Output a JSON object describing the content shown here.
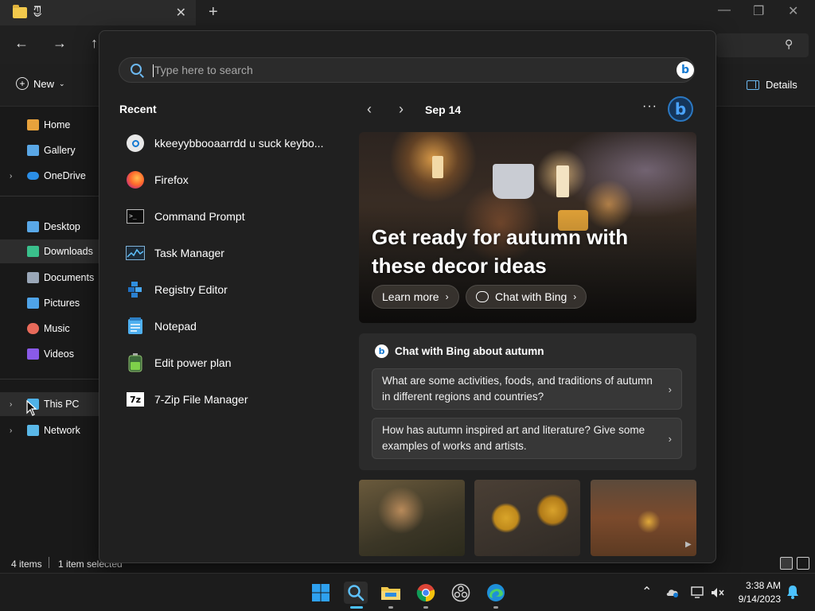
{
  "explorer": {
    "tab_title": "ཀྱ",
    "command_bar": {
      "new_label": "New",
      "details_label": "Details"
    },
    "sidebar": [
      {
        "label": "Home",
        "color": "#e8a23c"
      },
      {
        "label": "Gallery",
        "color": "#5aa7e6"
      },
      {
        "label": "OneDrive",
        "color": "#2b8ee6"
      },
      {
        "label": "Desktop",
        "color": "#59a8e8"
      },
      {
        "label": "Downloads",
        "color": "#3ac08c"
      },
      {
        "label": "Documents",
        "color": "#9aa7b8"
      },
      {
        "label": "Pictures",
        "color": "#4fa3e8"
      },
      {
        "label": "Music",
        "color": "#e86a5a"
      },
      {
        "label": "Videos",
        "color": "#8a5ae8"
      },
      {
        "label": "This PC",
        "color": "#4fb2e8"
      },
      {
        "label": "Network",
        "color": "#5ab8e8"
      }
    ],
    "status": {
      "items": "4 items",
      "selected": "1 item selected"
    }
  },
  "search": {
    "placeholder": "Type here to search"
  },
  "recent": {
    "title": "Recent",
    "items": [
      {
        "label": "kkeeyybbooaarrdd u suck keybo...",
        "icon": "search-icon"
      },
      {
        "label": "Firefox",
        "icon": "firefox-icon"
      },
      {
        "label": "Command Prompt",
        "icon": "command-prompt-icon"
      },
      {
        "label": "Task Manager",
        "icon": "task-manager-icon"
      },
      {
        "label": "Registry Editor",
        "icon": "registry-editor-icon"
      },
      {
        "label": "Notepad",
        "icon": "notepad-icon"
      },
      {
        "label": "Edit power plan",
        "icon": "power-plan-icon"
      },
      {
        "label": "7-Zip File Manager",
        "icon": "7zip-icon"
      }
    ]
  },
  "highlights": {
    "date": "Sep 14",
    "more": "···",
    "hero_title": "Get ready for autumn with these decor ideas",
    "learn_more": "Learn more",
    "chat_with_bing": "Chat with Bing",
    "chat_card_title": "Chat with Bing about autumn",
    "prompts": [
      "What are some activities, foods, and traditions of autumn in different regions and countries?",
      "How has autumn inspired art and literature? Give some examples of works and artists."
    ]
  },
  "taskbar": {
    "time": "3:38 AM",
    "date": "9/14/2023",
    "accent": "#4cc2ff"
  }
}
